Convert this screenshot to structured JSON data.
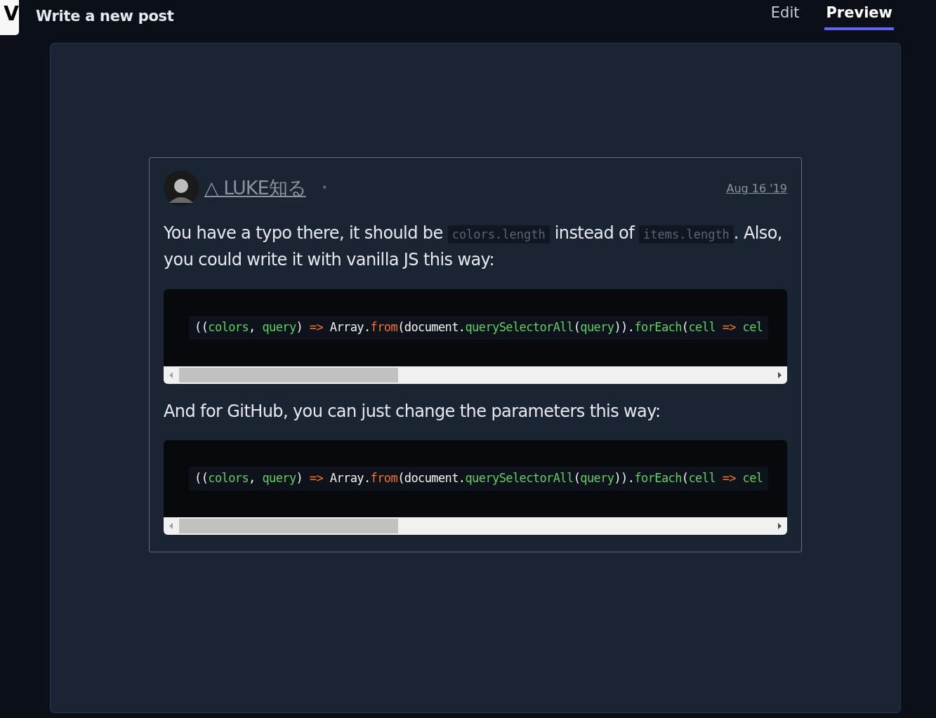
{
  "header": {
    "logo": "V",
    "title": "Write a new post",
    "tabs": [
      {
        "label": "Edit",
        "selected": false
      },
      {
        "label": "Preview",
        "selected": true
      }
    ]
  },
  "comment": {
    "author": "△ LUKE知る",
    "separator": "•",
    "date": "Aug 16 '19",
    "body": [
      {
        "kind": "paragraph",
        "parts": [
          {
            "kind": "text",
            "text": "You have a typo there, it should be "
          },
          {
            "kind": "code",
            "text": "colors.length"
          },
          {
            "kind": "text",
            "text": " instead of "
          },
          {
            "kind": "code",
            "text": "items.length"
          },
          {
            "kind": "text",
            "text": ". Also, you could write it with vanilla JS this way:"
          }
        ]
      },
      {
        "kind": "codeblock",
        "tokens": [
          {
            "kind": "plain",
            "text": "(("
          },
          {
            "kind": "name",
            "text": "colors"
          },
          {
            "kind": "plain",
            "text": ", "
          },
          {
            "kind": "name",
            "text": "query"
          },
          {
            "kind": "plain",
            "text": ") "
          },
          {
            "kind": "keyword",
            "text": "=>"
          },
          {
            "kind": "plain",
            "text": " Array."
          },
          {
            "kind": "keyword",
            "text": "from"
          },
          {
            "kind": "plain",
            "text": "(document."
          },
          {
            "kind": "name",
            "text": "querySelectorAll"
          },
          {
            "kind": "plain",
            "text": "("
          },
          {
            "kind": "name",
            "text": "query"
          },
          {
            "kind": "plain",
            "text": "))."
          },
          {
            "kind": "name",
            "text": "forEach"
          },
          {
            "kind": "plain",
            "text": "("
          },
          {
            "kind": "name",
            "text": "cell"
          },
          {
            "kind": "keyword",
            "text": " => "
          },
          {
            "kind": "name",
            "text": "cel"
          }
        ]
      },
      {
        "kind": "paragraph",
        "parts": [
          {
            "kind": "text",
            "text": "And for GitHub, you can just change the parameters this way:"
          }
        ]
      },
      {
        "kind": "codeblock",
        "tokens": [
          {
            "kind": "plain",
            "text": "(("
          },
          {
            "kind": "name",
            "text": "colors"
          },
          {
            "kind": "plain",
            "text": ", "
          },
          {
            "kind": "name",
            "text": "query"
          },
          {
            "kind": "plain",
            "text": ") "
          },
          {
            "kind": "keyword",
            "text": "=>"
          },
          {
            "kind": "plain",
            "text": " Array."
          },
          {
            "kind": "keyword",
            "text": "from"
          },
          {
            "kind": "plain",
            "text": "(document."
          },
          {
            "kind": "name",
            "text": "querySelectorAll"
          },
          {
            "kind": "plain",
            "text": "("
          },
          {
            "kind": "name",
            "text": "query"
          },
          {
            "kind": "plain",
            "text": "))."
          },
          {
            "kind": "name",
            "text": "forEach"
          },
          {
            "kind": "plain",
            "text": "("
          },
          {
            "kind": "name",
            "text": "cell"
          },
          {
            "kind": "keyword",
            "text": " => "
          },
          {
            "kind": "name",
            "text": "cel"
          }
        ]
      }
    ]
  }
}
